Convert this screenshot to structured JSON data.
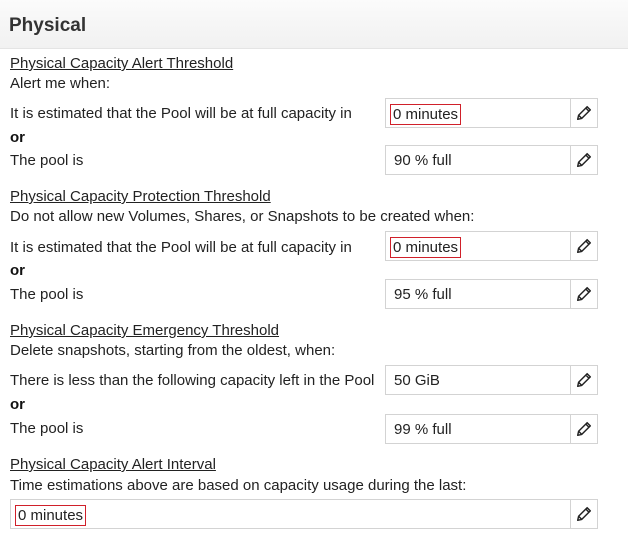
{
  "header": {
    "title": "Physical"
  },
  "alert": {
    "title": "Physical Capacity Alert Threshold",
    "description": "Alert me when:",
    "estimate_label": "It is estimated that the Pool will be at full capacity in",
    "estimate_value": "0 minutes",
    "or_label": "or",
    "pool_label": "The pool is",
    "pool_value": "90 % full"
  },
  "protection": {
    "title": "Physical Capacity Protection Threshold",
    "description": "Do not allow new Volumes, Shares, or Snapshots to be created when:",
    "estimate_label": "It is estimated that the Pool will be at full capacity in",
    "estimate_value": "0 minutes",
    "or_label": "or",
    "pool_label": "The pool is",
    "pool_value": "95 % full"
  },
  "emergency": {
    "title": "Physical Capacity Emergency Threshold",
    "description": "Delete snapshots, starting from the oldest, when:",
    "capacity_label": "There is less than the following capacity left in the Pool",
    "capacity_value": "50 GiB",
    "or_label": "or",
    "pool_label": "The pool is",
    "pool_value": "99 % full"
  },
  "interval": {
    "title": "Physical Capacity Alert Interval",
    "description": "Time estimations above are based on capacity usage during the last:",
    "value": "0 minutes"
  },
  "icons": {
    "edit": "pencil-icon"
  },
  "colors": {
    "highlight_border": "#d0202a"
  }
}
